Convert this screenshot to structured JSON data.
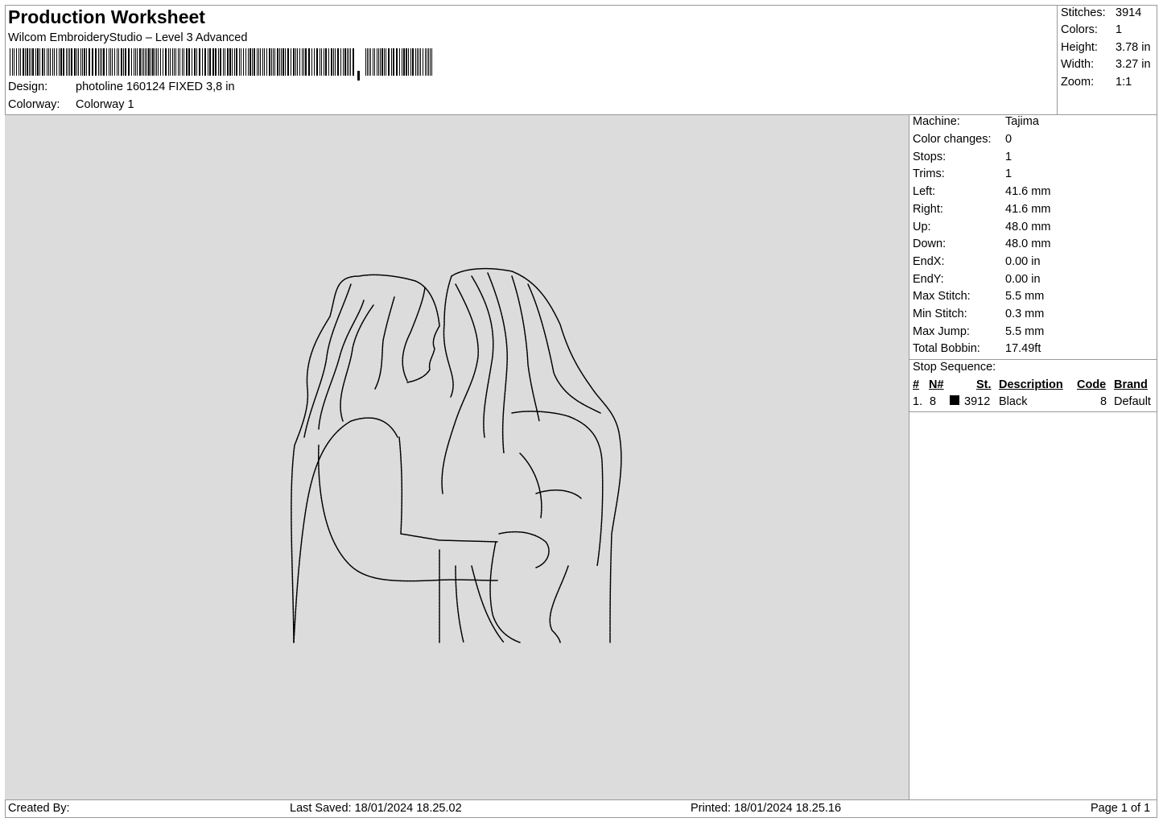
{
  "header": {
    "title": "Production Worksheet",
    "software": "Wilcom EmbroideryStudio – Level 3 Advanced",
    "design_label": "Design:",
    "design_value": "photoline 160124 FIXED 3,8 in",
    "colorway_label": "Colorway:",
    "colorway_value": "Colorway 1"
  },
  "summary": [
    {
      "label": "Stitches:",
      "value": "3914"
    },
    {
      "label": "Colors:",
      "value": "1"
    },
    {
      "label": "Height:",
      "value": "3.78 in"
    },
    {
      "label": "Width:",
      "value": "3.27 in"
    },
    {
      "label": "Zoom:",
      "value": "1:1"
    }
  ],
  "machine_info": [
    {
      "label": "Machine:",
      "value": "Tajima"
    },
    {
      "label": "Color changes:",
      "value": "0"
    },
    {
      "label": "Stops:",
      "value": "1"
    },
    {
      "label": "Trims:",
      "value": "1"
    },
    {
      "label": "Left:",
      "value": "41.6 mm"
    },
    {
      "label": "Right:",
      "value": "41.6 mm"
    },
    {
      "label": "Up:",
      "value": "48.0 mm"
    },
    {
      "label": "Down:",
      "value": "48.0 mm"
    },
    {
      "label": "EndX:",
      "value": "0.00 in"
    },
    {
      "label": "EndY:",
      "value": "0.00 in"
    },
    {
      "label": "Max Stitch:",
      "value": "5.5 mm"
    },
    {
      "label": "Min Stitch:",
      "value": "0.3 mm"
    },
    {
      "label": "Max Jump:",
      "value": "5.5 mm"
    },
    {
      "label": "Total Bobbin:",
      "value": "17.49ft"
    }
  ],
  "stop_sequence": {
    "title": "Stop Sequence:",
    "columns": [
      "#",
      "N#",
      "St.",
      "Description",
      "Code",
      "Brand"
    ],
    "rows": [
      {
        "num": "1.",
        "needle": "8",
        "stitches": "3912",
        "description": "Black",
        "code": "8",
        "brand": "Default",
        "color": "#000000"
      }
    ]
  },
  "footer": {
    "created_by": "Created By:",
    "last_saved": "Last Saved: 18/01/2024 18.25.02",
    "printed": "Printed: 18/01/2024 18.25.16",
    "page": "Page 1 of 1"
  },
  "colors": {
    "canvas_bg": "#dcdcdc",
    "thread": "#000000",
    "border": "#999999"
  }
}
